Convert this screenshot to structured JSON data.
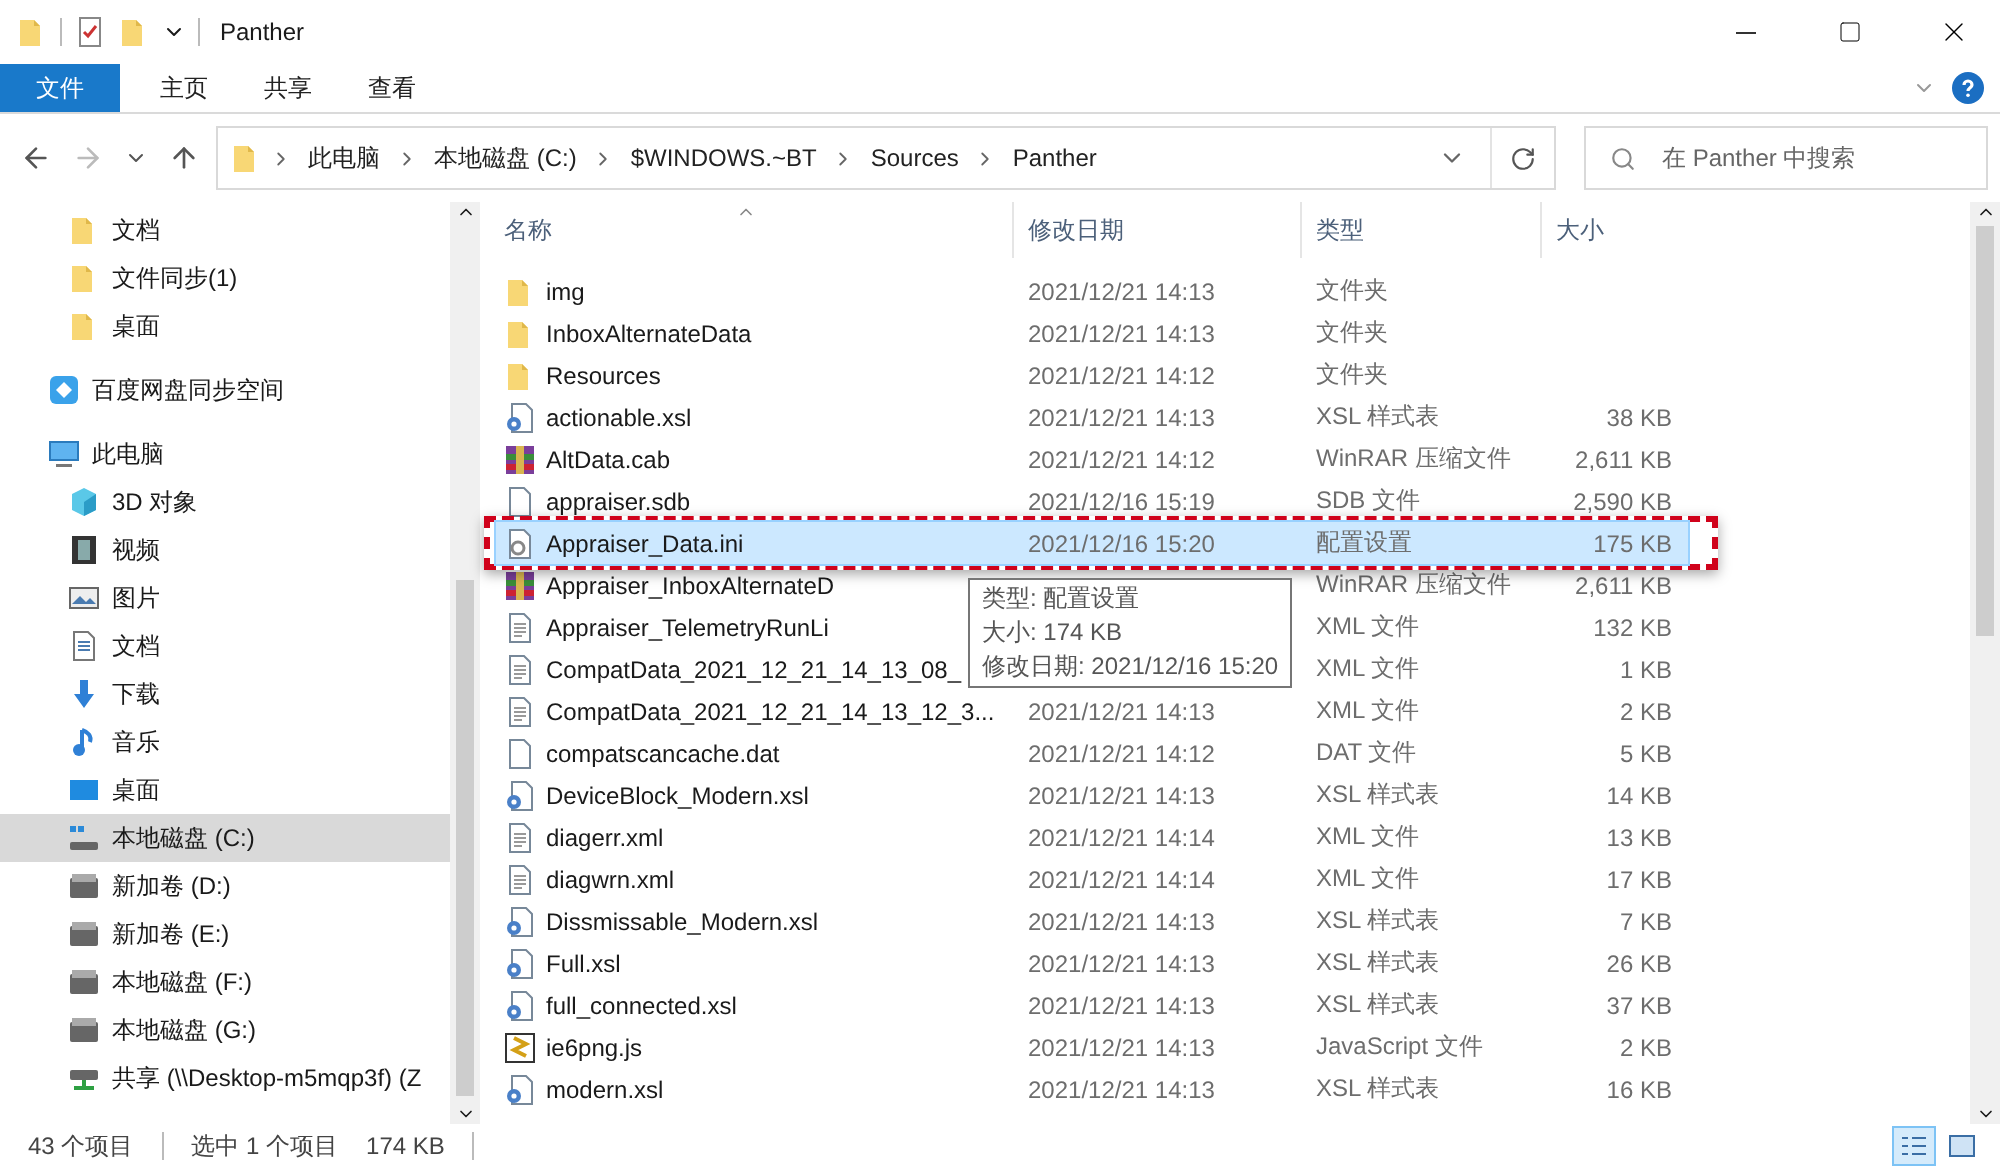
{
  "window": {
    "title": "Panther"
  },
  "ribbon": {
    "tabs": [
      {
        "label": "文件",
        "selected": true
      },
      {
        "label": "主页",
        "selected": false
      },
      {
        "label": "共享",
        "selected": false
      },
      {
        "label": "查看",
        "selected": false
      }
    ]
  },
  "address": {
    "segments": [
      "此电脑",
      "本地磁盘 (C:)",
      "$WINDOWS.~BT",
      "Sources",
      "Panther"
    ],
    "search_placeholder": "在 Panther 中搜索"
  },
  "sidebar": {
    "continued_items": [
      {
        "label": "文档",
        "kind": "folder",
        "selected": false
      },
      {
        "label": "文件同步(1)",
        "kind": "folder",
        "selected": false
      },
      {
        "label": "桌面",
        "kind": "folder",
        "selected": false
      }
    ],
    "items": [
      {
        "label": "百度网盘同步空间",
        "kind": "cloud",
        "selected": false
      },
      {
        "label": "此电脑",
        "kind": "pc",
        "selected": false,
        "children": [
          {
            "label": "3D 对象",
            "kind": "cube",
            "selected": false
          },
          {
            "label": "视频",
            "kind": "video",
            "selected": false
          },
          {
            "label": "图片",
            "kind": "picture",
            "selected": false
          },
          {
            "label": "文档",
            "kind": "doc",
            "selected": false
          },
          {
            "label": "下载",
            "kind": "download",
            "selected": false
          },
          {
            "label": "音乐",
            "kind": "music",
            "selected": false
          },
          {
            "label": "桌面",
            "kind": "desktop",
            "selected": false
          },
          {
            "label": "本地磁盘 (C:)",
            "kind": "sysdrive",
            "selected": true
          },
          {
            "label": "新加卷 (D:)",
            "kind": "drive",
            "selected": false
          },
          {
            "label": "新加卷 (E:)",
            "kind": "drive",
            "selected": false
          },
          {
            "label": "本地磁盘 (F:)",
            "kind": "drive",
            "selected": false
          },
          {
            "label": "本地磁盘 (G:)",
            "kind": "drive",
            "selected": false
          },
          {
            "label": "共享 (\\\\Desktop-m5mqp3f) (Z",
            "kind": "network",
            "selected": false
          }
        ]
      }
    ]
  },
  "table": {
    "columns": [
      "名称",
      "修改日期",
      "类型",
      "大小"
    ],
    "rows": [
      {
        "name": "img",
        "date": "2021/12/21 14:13",
        "type": "文件夹",
        "kind": "folder",
        "selected": false
      },
      {
        "name": "InboxAlternateData",
        "date": "2021/12/21 14:13",
        "type": "文件夹",
        "kind": "folder",
        "selected": false
      },
      {
        "name": "Resources",
        "date": "2021/12/21 14:12",
        "type": "文件夹",
        "kind": "folder",
        "selected": false
      },
      {
        "name": "actionable.xsl",
        "date": "2021/12/21 14:13",
        "type": "XSL 样式表",
        "size": "38 KB",
        "kind": "xsl",
        "selected": false
      },
      {
        "name": "AltData.cab",
        "date": "2021/12/21 14:12",
        "type": "WinRAR 压缩文件",
        "size": "2,611 KB",
        "kind": "cab",
        "selected": false
      },
      {
        "name": "appraiser.sdb",
        "date": "2021/12/16 15:19",
        "type": "SDB 文件",
        "size": "2,590 KB",
        "kind": "file",
        "selected": false
      },
      {
        "name": "Appraiser_Data.ini",
        "date": "2021/12/16 15:20",
        "type": "配置设置",
        "size": "175 KB",
        "kind": "ini",
        "selected": true,
        "annotated": true
      },
      {
        "name": "Appraiser_InboxAlternateD",
        "type": "WinRAR 压缩文件",
        "size": "2,611 KB",
        "kind": "cab",
        "selected": false
      },
      {
        "name": "Appraiser_TelemetryRunLi",
        "type": "XML 文件",
        "size": "132 KB",
        "kind": "xml",
        "selected": false
      },
      {
        "name": "CompatData_2021_12_21_14_13_08_",
        "type": "XML 文件",
        "size": "1 KB",
        "kind": "xml",
        "selected": false
      },
      {
        "name": "CompatData_2021_12_21_14_13_12_3...",
        "date": "2021/12/21 14:13",
        "type": "XML 文件",
        "size": "2 KB",
        "kind": "xml",
        "selected": false
      },
      {
        "name": "compatscancache.dat",
        "date": "2021/12/21 14:12",
        "type": "DAT 文件",
        "size": "5 KB",
        "kind": "file",
        "selected": false
      },
      {
        "name": "DeviceBlock_Modern.xsl",
        "date": "2021/12/21 14:13",
        "type": "XSL 样式表",
        "size": "14 KB",
        "kind": "xsl",
        "selected": false
      },
      {
        "name": "diagerr.xml",
        "date": "2021/12/21 14:14",
        "type": "XML 文件",
        "size": "13 KB",
        "kind": "xml",
        "selected": false
      },
      {
        "name": "diagwrn.xml",
        "date": "2021/12/21 14:14",
        "type": "XML 文件",
        "size": "17 KB",
        "kind": "xml",
        "selected": false
      },
      {
        "name": "Dissmissable_Modern.xsl",
        "date": "2021/12/21 14:13",
        "type": "XSL 样式表",
        "size": "7 KB",
        "kind": "xsl",
        "selected": false
      },
      {
        "name": "Full.xsl",
        "date": "2021/12/21 14:13",
        "type": "XSL 样式表",
        "size": "26 KB",
        "kind": "xsl",
        "selected": false
      },
      {
        "name": "full_connected.xsl",
        "date": "2021/12/21 14:13",
        "type": "XSL 样式表",
        "size": "37 KB",
        "kind": "xsl",
        "selected": false
      },
      {
        "name": "ie6png.js",
        "date": "2021/12/21 14:13",
        "type": "JavaScript 文件",
        "size": "2 KB",
        "kind": "js",
        "selected": false
      },
      {
        "name": "modern.xsl",
        "date": "2021/12/21 14:13",
        "type": "XSL 样式表",
        "size": "16 KB",
        "kind": "xsl",
        "selected": false
      }
    ]
  },
  "tooltip": {
    "lines": [
      "类型: 配置设置",
      "大小: 174 KB",
      "修改日期: 2021/12/16 15:20"
    ]
  },
  "status_bar": {
    "item_count": "43 个项目",
    "selection": "选中 1 个项目",
    "selection_size": "174 KB",
    "views": [
      {
        "kind": "details",
        "selected": true
      },
      {
        "kind": "thumbnails",
        "selected": false
      }
    ]
  }
}
